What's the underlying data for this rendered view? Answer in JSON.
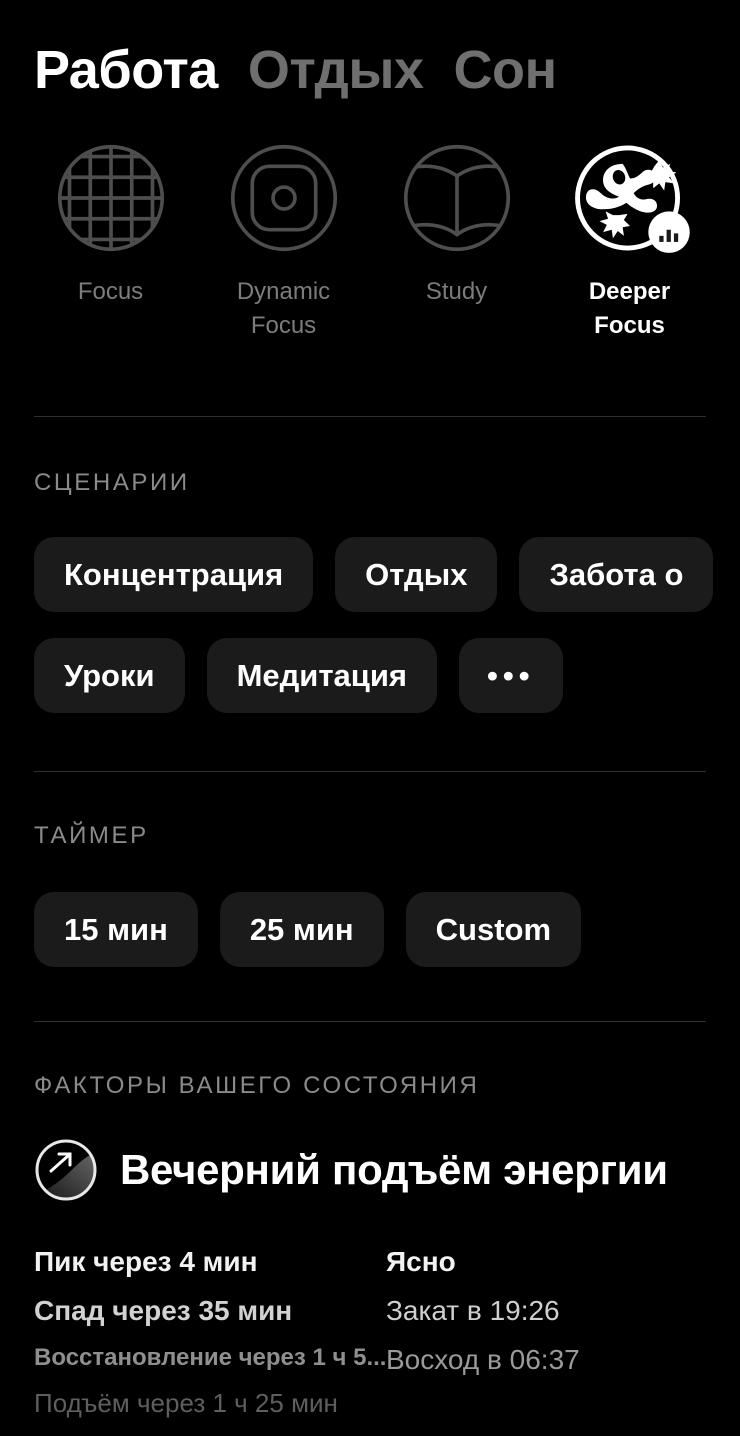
{
  "tabs": [
    {
      "label": "Работа",
      "active": true
    },
    {
      "label": "Отдых",
      "active": false
    },
    {
      "label": "Сон",
      "active": false
    }
  ],
  "modes": [
    {
      "label": "Focus",
      "icon": "grid-circle-icon",
      "selected": false
    },
    {
      "label": "Dynamic\nFocus",
      "icon": "rounded-square-dot-icon",
      "selected": false
    },
    {
      "label": "Study",
      "icon": "open-book-circle-icon",
      "selected": false
    },
    {
      "label": "Deeper\nFocus",
      "icon": "gecko-badge-icon",
      "selected": true
    }
  ],
  "scenarios": {
    "heading": "СЦЕНАРИИ",
    "row1": [
      "Концентрация",
      "Отдых",
      "Забота о"
    ],
    "row2": [
      "Уроки",
      "Медитация",
      "•••"
    ]
  },
  "timer": {
    "heading": "ТАЙМЕР",
    "options": [
      "15 мин",
      "25 мин",
      "Custom"
    ]
  },
  "factors": {
    "heading": "ФАКТОРЫ ВАШЕГО СОСТОЯНИЯ",
    "title": "Вечерний подъём энергии",
    "badge_icon": "trend-up-circle-icon",
    "left": [
      "Пик через 4 мин",
      "Спад через 35 мин",
      "Восстановление через 1 ч 5...",
      "Подъём через 1 ч 25 мин"
    ],
    "right": [
      "Ясно",
      "Закат в 19:26",
      "Восход в 06:37"
    ]
  },
  "colors": {
    "background": "#000000",
    "chip_bg": "#1b1b1b",
    "divider": "#303030",
    "muted": "#7c7c7c",
    "accent": "#ffffff"
  }
}
